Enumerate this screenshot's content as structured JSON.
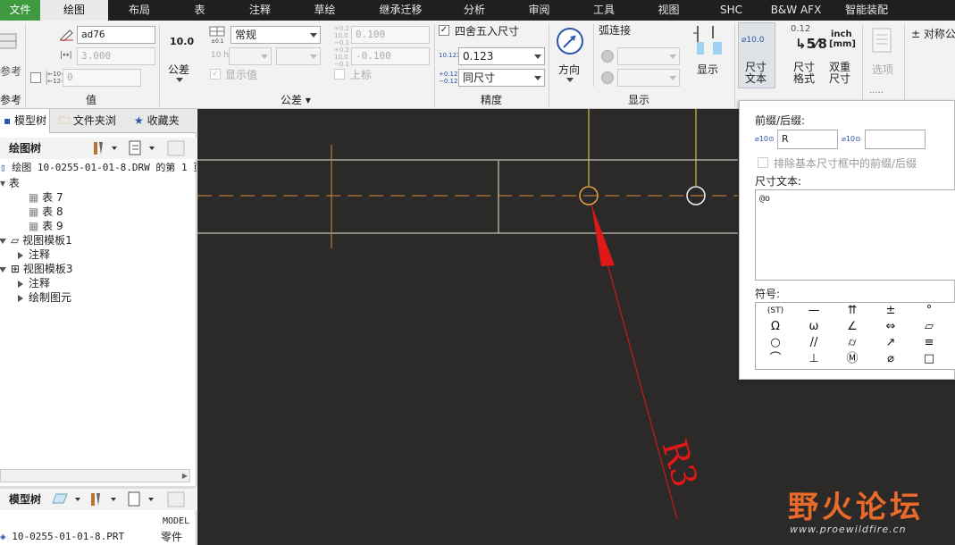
{
  "menu": [
    "文件",
    "绘图",
    "布局",
    "表",
    "注释",
    "草绘",
    "继承迁移",
    "分析",
    "审阅",
    "工具",
    "视图",
    "SHC",
    "B&W AFX",
    "智能装配"
  ],
  "ribbon": {
    "ref_label": "参考",
    "value_group": {
      "name_value": "ad76",
      "nominal_value": "3.000",
      "tol_value": "0",
      "label": "值"
    },
    "tolerance_group": {
      "precision_icon": "10.0",
      "tol_button": "公差",
      "mode": "常规",
      "show_value": "显示值",
      "upper": "0.100",
      "lower": "-0.100",
      "superscript": "上标",
      "label": "公差"
    },
    "precision_group": {
      "round": "四舍五入尺寸",
      "decimals": "0.123",
      "same_dim": "同尺寸",
      "label": "精度"
    },
    "display_group": {
      "direction": "方向",
      "arc_connect": "弧连接",
      "display": "显示",
      "label": "显示"
    },
    "format_group": {
      "dim_text": "尺寸\n文本",
      "dim_format": "尺寸\n格式",
      "dual_dim": "双重\n尺寸",
      "options": "选项",
      "symmetric": "对称公",
      "frac": "5⁄8",
      "frac_top": "0.12",
      "inch": "inch",
      "mm": "[mm]",
      "dim_icon": "⌀10.0"
    }
  },
  "left": {
    "tabs": [
      "模型树",
      "文件夹浏",
      "收藏夹"
    ],
    "tree_header": "绘图树",
    "tree": [
      {
        "label": "绘图 10-0255-01-01-8.DRW 的第 1 页",
        "indent": 0
      },
      {
        "label": "表",
        "indent": 0
      },
      {
        "label": "表 7",
        "indent": 2
      },
      {
        "label": "表 8",
        "indent": 2
      },
      {
        "label": "表 9",
        "indent": 2
      },
      {
        "label": "视图模板1",
        "indent": 1
      },
      {
        "label": "注释",
        "indent": 2
      },
      {
        "label": "视图模板3",
        "indent": 1
      },
      {
        "label": "注释",
        "indent": 2
      },
      {
        "label": "绘制图元",
        "indent": 2
      }
    ],
    "model_tree_header": "模型树",
    "model_col": "MODEL",
    "model_item": "10-0255-01-01-8.PRT",
    "model_item_type": "零件"
  },
  "canvas": {
    "dim_text": "R3"
  },
  "popup": {
    "prefix_suffix_label": "前缀/后缀:",
    "prefix_value": "R",
    "suffix_value": "",
    "exclude_label": "排除基本尺寸框中的前缀/后缀",
    "dim_text_label": "尺寸文本:",
    "dim_text_value": "@o",
    "symbols_label": "符号:",
    "symbols": [
      "ST",
      "—",
      "⇈",
      "±",
      "°",
      "Ω",
      "ω",
      "∠",
      "⇔",
      "▱",
      "○",
      "//",
      "⌭",
      "↗",
      "≡",
      "⌒",
      "⊥",
      "Ⓜ",
      "⌀",
      "□"
    ]
  },
  "watermark": {
    "text": "野火论坛",
    "url": "www.proewildfire.cn"
  }
}
